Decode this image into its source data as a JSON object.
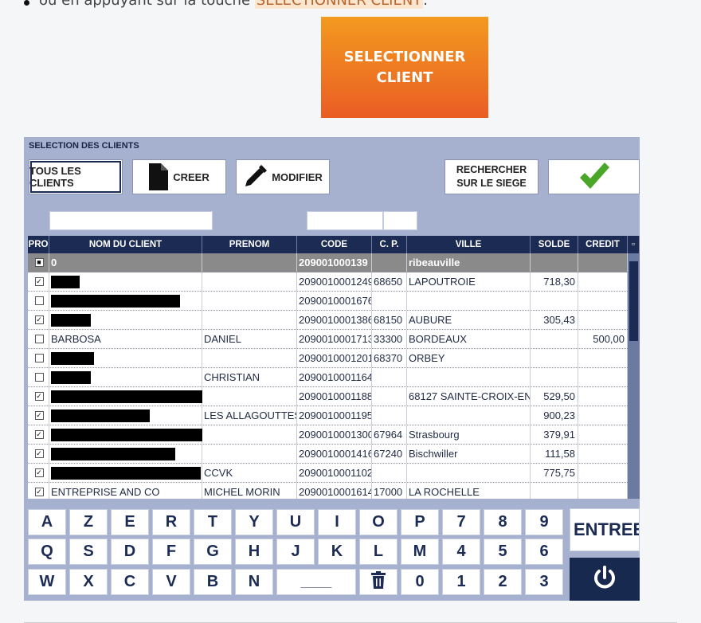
{
  "intro": {
    "text": "ou en appuyant sur la touche",
    "key": "SELECTIONNER CLIENT",
    "end": "."
  },
  "big_button": {
    "line1": "SELECTIONNER",
    "line2": "CLIENT"
  },
  "panel": {
    "title": "SELECTION DES CLIENTS",
    "tous_label": "TOUS LES CLIENTS",
    "creer_label": "CREER",
    "modifier_label": "MODIFIER",
    "rechercher_line1": "RECHERCHER",
    "rechercher_line2": "SUR LE SIEGE"
  },
  "table": {
    "headers": [
      "PRO",
      "NOM DU CLIENT",
      "PRENOM",
      "CODE",
      "C. P.",
      "VILLE",
      "SOLDE",
      "CREDIT"
    ],
    "rows": [
      {
        "chk": "■",
        "nom": "0",
        "prenom": "",
        "code": "209001000139",
        "cp": "",
        "ville": "ribeauville",
        "solde": "",
        "credit": ""
      },
      {
        "chk": "✓",
        "nom": "",
        "prenom": "",
        "code": "2090010001249",
        "cp": "68650",
        "ville": "LAPOUTROIE",
        "solde": "718,30",
        "credit": ""
      },
      {
        "chk": "",
        "nom": "",
        "prenom": "",
        "code": "2090010001676",
        "cp": "",
        "ville": "",
        "solde": "",
        "credit": ""
      },
      {
        "chk": "✓",
        "nom": "",
        "prenom": "",
        "code": "2090010001386",
        "cp": "68150",
        "ville": "AUBURE",
        "solde": "305,43",
        "credit": ""
      },
      {
        "chk": "",
        "nom": "BARBOSA",
        "prenom": "DANIEL",
        "code": "2090010001713",
        "cp": "33300",
        "ville": "BORDEAUX",
        "solde": "",
        "credit": "500,00"
      },
      {
        "chk": "",
        "nom": "",
        "prenom": "",
        "code": "2090010001201",
        "cp": "68370",
        "ville": "ORBEY",
        "solde": "",
        "credit": ""
      },
      {
        "chk": "",
        "nom": "",
        "prenom": "CHRISTIAN",
        "code": "2090010001164",
        "cp": "",
        "ville": "",
        "solde": "",
        "credit": ""
      },
      {
        "chk": "✓",
        "nom": "",
        "prenom": "",
        "code": "2090010001188",
        "cp": "",
        "ville": "68127 SAINTE-CROIX-EN-P",
        "solde": "529,50",
        "credit": ""
      },
      {
        "chk": "✓",
        "nom": "",
        "prenom": "LES ALLAGOUTTES",
        "code": "2090010001195",
        "cp": "",
        "ville": "",
        "solde": "900,23",
        "credit": ""
      },
      {
        "chk": "✓",
        "nom": "",
        "prenom": "",
        "code": "2090010001300",
        "cp": "67964",
        "ville": "Strasbourg",
        "solde": "379,91",
        "credit": ""
      },
      {
        "chk": "✓",
        "nom": "",
        "prenom": "",
        "code": "2090010001416",
        "cp": "67240",
        "ville": "Bischwiller",
        "solde": "111,58",
        "credit": ""
      },
      {
        "chk": "✓",
        "nom": "",
        "prenom": "CCVK",
        "code": "2090010001102",
        "cp": "",
        "ville": "",
        "solde": "775,75",
        "credit": ""
      },
      {
        "chk": "✓",
        "nom": "ENTREPRISE AND CO",
        "prenom": "MICHEL MORIN",
        "code": "2090010001614",
        "cp": "17000",
        "ville": "LA ROCHELLE",
        "solde": "",
        "credit": ""
      }
    ]
  },
  "keyboard": {
    "row1": [
      "A",
      "Z",
      "E",
      "R",
      "T",
      "Y",
      "U",
      "I",
      "O",
      "P",
      "7",
      "8",
      "9"
    ],
    "row2": [
      "Q",
      "S",
      "D",
      "F",
      "G",
      "H",
      "J",
      "K",
      "L",
      "M",
      "4",
      "5",
      "6"
    ],
    "row3": [
      "W",
      "X",
      "C",
      "V",
      "B",
      "N",
      "_____",
      "trash-icon",
      "0",
      "1",
      "2",
      "3"
    ],
    "entree": "ENTREE"
  },
  "colors": {
    "accent": "#1b2b54",
    "panel": "#a6b0cf",
    "check": "#4aa629",
    "orange": "#ef7b22"
  }
}
